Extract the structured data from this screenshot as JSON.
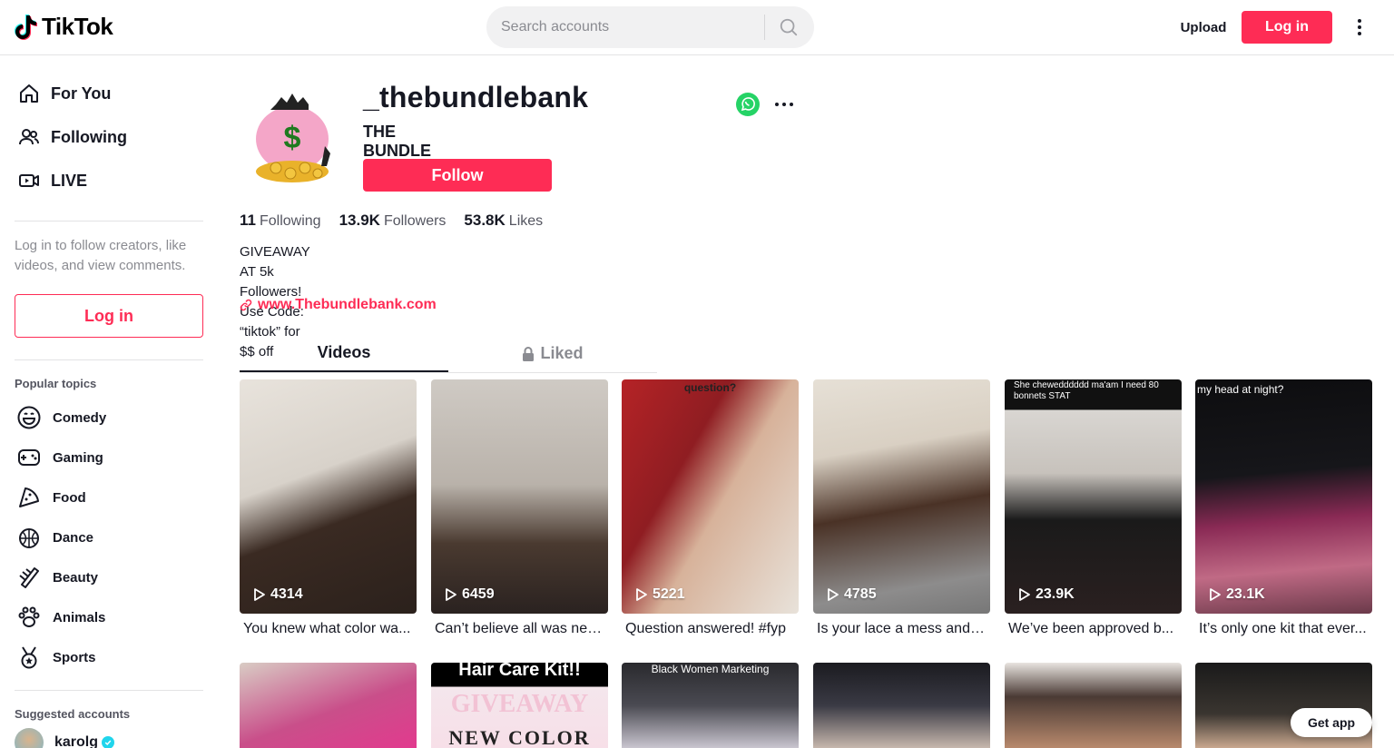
{
  "header": {
    "logo_text": "TikTok",
    "search_placeholder": "Search accounts",
    "upload_label": "Upload",
    "login_label": "Log in"
  },
  "sidebar": {
    "nav": [
      {
        "label": "For You",
        "icon": "home-icon"
      },
      {
        "label": "Following",
        "icon": "users-icon"
      },
      {
        "label": "LIVE",
        "icon": "live-camera-icon"
      }
    ],
    "login_prompt": "Log in to follow creators, like videos, and view comments.",
    "login_button": "Log in",
    "popular_title": "Popular topics",
    "topics": [
      {
        "label": "Comedy",
        "icon": "smiley-icon"
      },
      {
        "label": "Gaming",
        "icon": "gamepad-icon"
      },
      {
        "label": "Food",
        "icon": "pizza-icon"
      },
      {
        "label": "Dance",
        "icon": "disco-ball-icon"
      },
      {
        "label": "Beauty",
        "icon": "comb-icon"
      },
      {
        "label": "Animals",
        "icon": "paw-icon"
      },
      {
        "label": "Sports",
        "icon": "medal-icon"
      }
    ],
    "suggested_title": "Suggested accounts",
    "suggested": [
      {
        "name": "karolg",
        "verified": true
      }
    ]
  },
  "profile": {
    "username": "_thebundlebank",
    "display_name": "THE BUNDLE BANK",
    "follow_label": "Follow",
    "stats": {
      "following_count": "11",
      "following_label": "Following",
      "followers_count": "13.9K",
      "followers_label": "Followers",
      "likes_count": "53.8K",
      "likes_label": "Likes"
    },
    "bio_line1": "GIVEAWAY AT 5k Followers!",
    "bio_line2": "Use Code: “tiktok” for $$ off",
    "link": "www.Thebundlebank.com",
    "tabs": {
      "videos": "Videos",
      "liked": "Liked"
    }
  },
  "videos": [
    {
      "views": "4314",
      "caption": "You knew what color wa..."
    },
    {
      "views": "6459",
      "caption": "Can’t believe all was nee..."
    },
    {
      "views": "5221",
      "caption": "Question answered! #fyp",
      "overlay": "question?"
    },
    {
      "views": "4785",
      "caption": "Is your lace a mess and ..."
    },
    {
      "views": "23.9K",
      "caption": "We’ve been approved b...",
      "overlay": "She chewedddddd ma'am I need 80 bonnets STAT"
    },
    {
      "views": "23.1K",
      "caption": "It’s only one kit that ever...",
      "overlay": "my head at night?"
    }
  ],
  "videos_row2": [
    {
      "overlay": ""
    },
    {
      "overlay": "Hair Care Kit!!",
      "overlay2": "GIVEAWAY",
      "overlay3": "NEW COLOR"
    },
    {
      "overlay": "Black Women Marketing"
    },
    {
      "overlay": ""
    },
    {
      "overlay": ""
    },
    {
      "overlay": ""
    }
  ],
  "get_app_label": "Get app",
  "colors": {
    "accent": "#fe2c55",
    "text": "#161823",
    "muted": "#8a8b91"
  }
}
